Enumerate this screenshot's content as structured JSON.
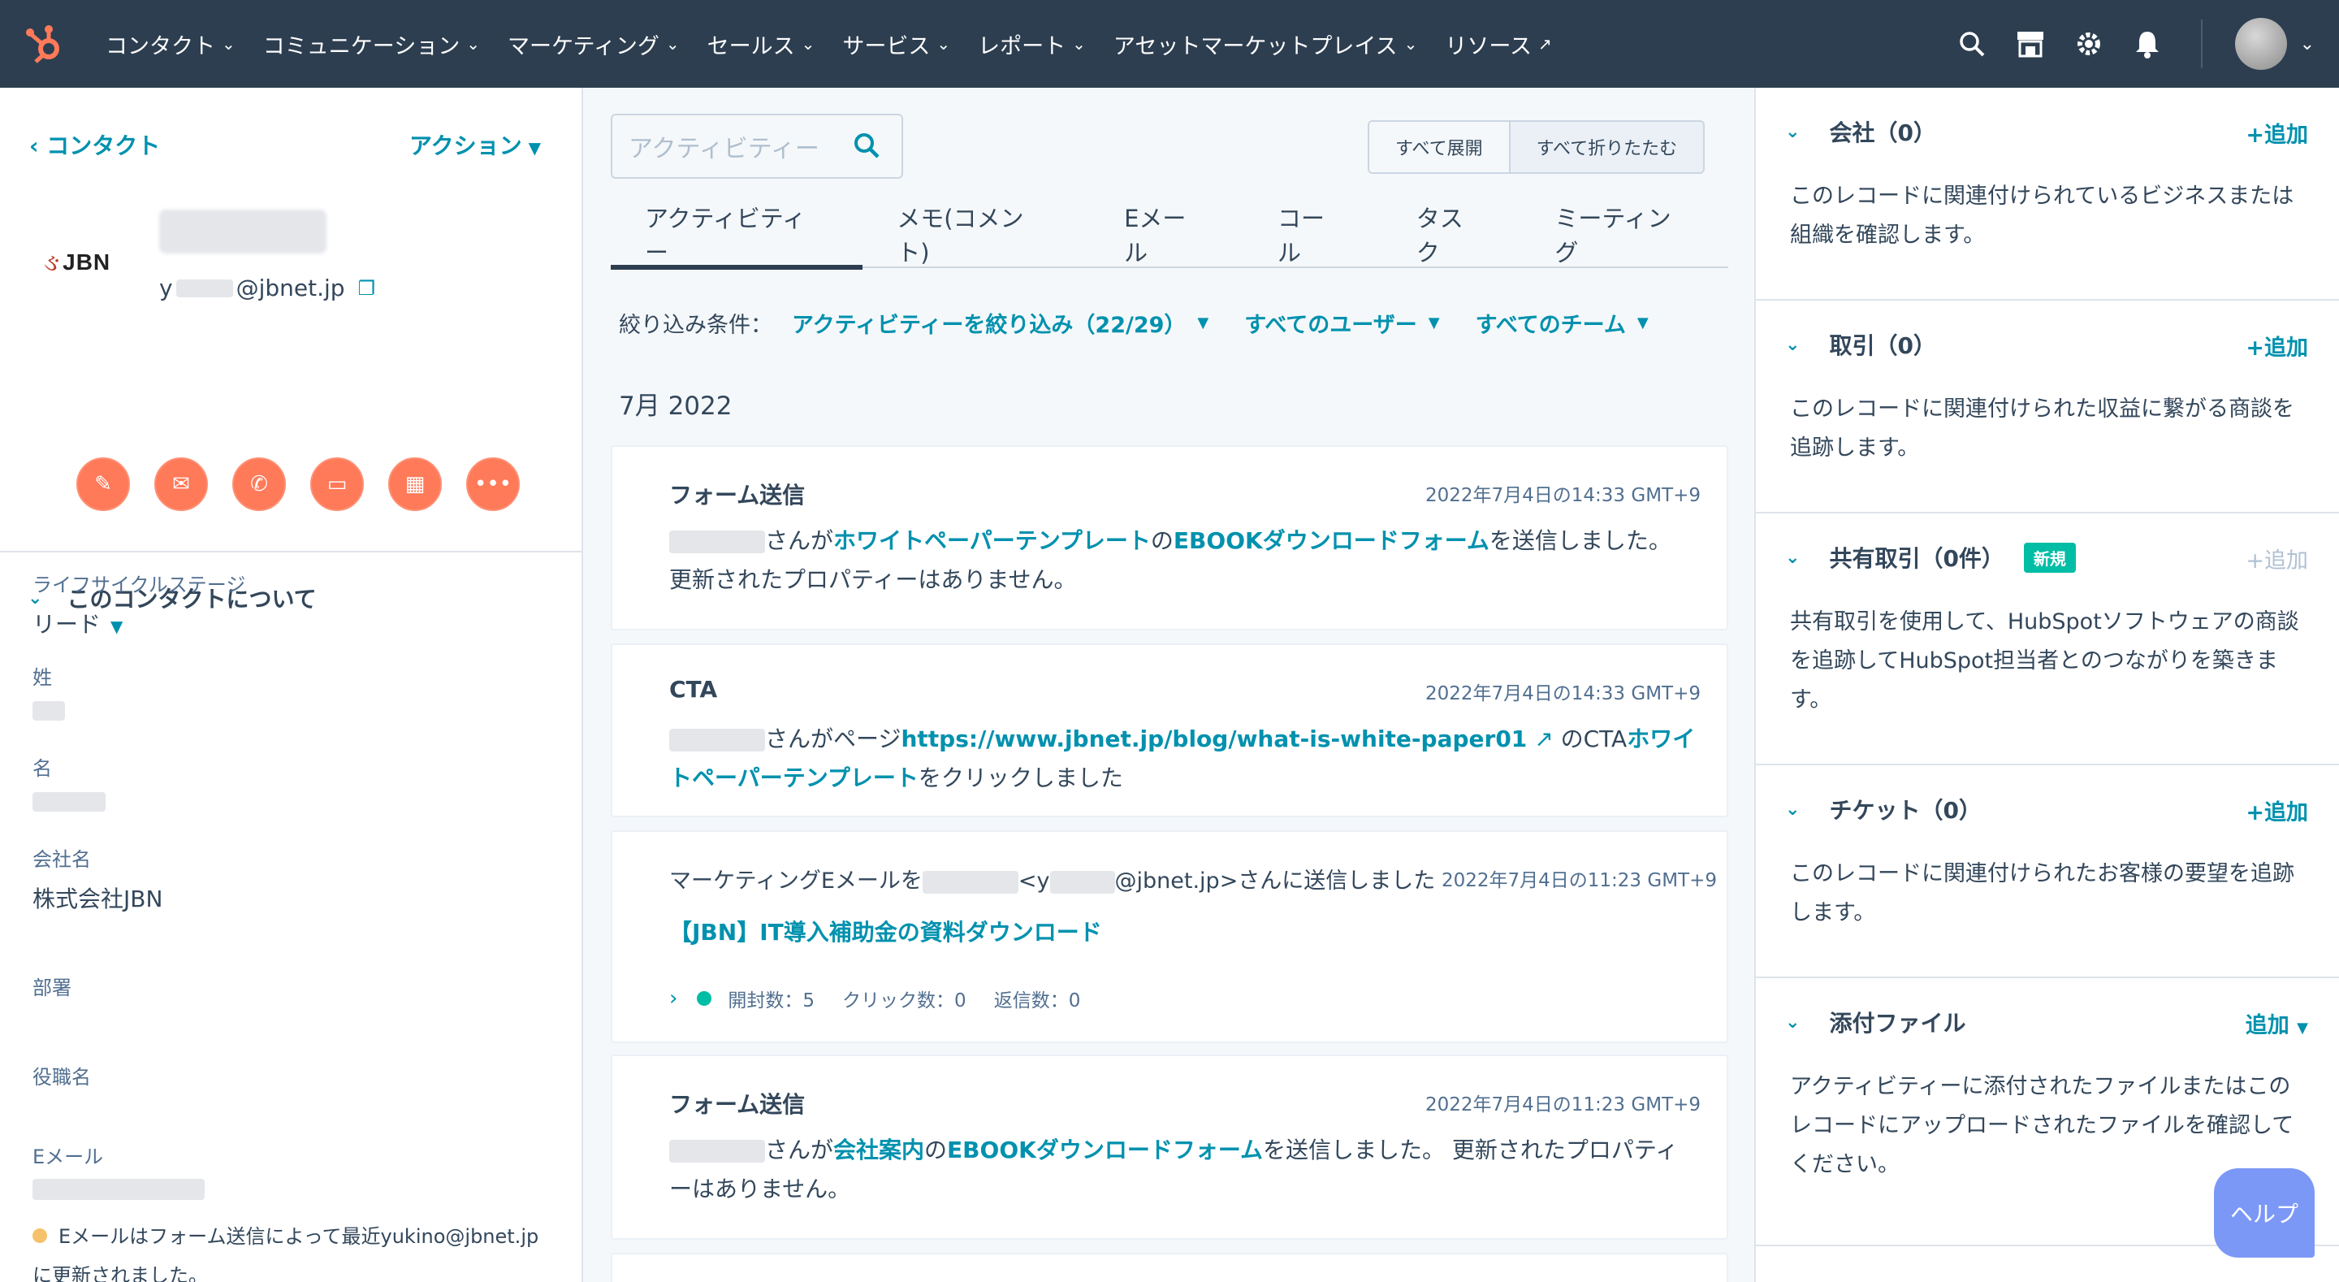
{
  "nav": {
    "items": [
      "コンタクト",
      "コミュニケーション",
      "マーケティング",
      "セールス",
      "サービス",
      "レポート",
      "アセットマーケットプレイス"
    ],
    "resources": "リソース",
    "icons": [
      "search-icon",
      "marketplace-icon",
      "gear-icon",
      "bell-icon"
    ]
  },
  "left": {
    "back_label": "コンタクト",
    "actions_label": "アクション",
    "company_logo_text": "JBN",
    "email_prefix": "y",
    "email_domain": "@jbnet.jp",
    "action_buttons": [
      "note",
      "email",
      "call",
      "log",
      "task",
      "more"
    ],
    "about_title": "このコンタクトについて",
    "props": {
      "lifecycle_label": "ライフサイクルステージ",
      "lifecycle_value": "リード",
      "last_name_label": "姓",
      "first_name_label": "名",
      "company_label": "会社名",
      "company_value": "株式会社JBN",
      "department_label": "部署",
      "title_label": "役職名",
      "email_label": "Eメール"
    },
    "notice": "Eメールはフォーム送信によって最近yukino@jbnet.jpに更新されました。"
  },
  "center": {
    "search_placeholder": "アクティビティー",
    "expand_all": "すべて展開",
    "collapse_all": "すべて折りたたむ",
    "tabs": [
      "アクティビティー",
      "メモ(コメント)",
      "Eメール",
      "コール",
      "タスク",
      "ミーティング"
    ],
    "filter_label": "絞り込み条件：",
    "filters": [
      "アクティビティーを絞り込み（22/29）",
      "すべてのユーザー",
      "すべてのチーム"
    ],
    "month": "7月 2022",
    "cards": [
      {
        "title": "フォーム送信",
        "time": "2022年7月4日の14:33 GMT+9",
        "t1": "さんが",
        "link1": "ホワイトペーパーテンプレート",
        "t2": "の",
        "link2": "EBOOKダウンロードフォーム",
        "t3": "を送信しました。 更新されたプロパティーはありません。"
      },
      {
        "title": "CTA",
        "time": "2022年7月4日の14:33 GMT+9",
        "t1": "さんがページ",
        "link1": "https://www.jbnet.jp/blog/what-is-white-paper01",
        "t2": "のCTA",
        "link2": "ホワイトペーパーテンプレート",
        "t3": "をクリックしました"
      },
      {
        "title_prefix": "マーケティングEメールを",
        "title_mid": "<y",
        "title_suffix": "@jbnet.jp>さんに送信しました",
        "time": "2022年7月4日の11:23 GMT+9",
        "subject": "【JBN】IT導入補助金の資料ダウンロード",
        "opens": "開封数：5",
        "clicks": "クリック数：0",
        "replies": "返信数：0"
      },
      {
        "title": "フォーム送信",
        "time": "2022年7月4日の11:23 GMT+9",
        "t1": "さんが",
        "link1": "会社案内",
        "t2": "の",
        "link2": "EBOOKダウンロードフォーム",
        "t3": "を送信しました。 更新されたプロパティーはありません。"
      }
    ]
  },
  "right": {
    "sections": [
      {
        "title": "会社（0）",
        "add": "+追加",
        "body": "このレコードに関連付けられているビジネスまたは組織を確認します。"
      },
      {
        "title": "取引（0）",
        "add": "+追加",
        "body": "このレコードに関連付けられた収益に繋がる商談を追跡します。"
      },
      {
        "title": "共有取引（0件）",
        "badge": "新規",
        "add": "+追加",
        "body": "共有取引を使用して、HubSpotソフトウェアの商談を追跡してHubSpot担当者とのつながりを築きます。"
      },
      {
        "title": "チケット（0）",
        "add": "+追加",
        "body": "このレコードに関連付けられたお客様の要望を追跡します。"
      },
      {
        "title": "添付ファイル",
        "add": "追加",
        "body": "アクティビティーに添付されたファイルまたはこのレコードにアップロードされたファイルを確認してください。"
      }
    ]
  },
  "help_label": "ヘルプ"
}
